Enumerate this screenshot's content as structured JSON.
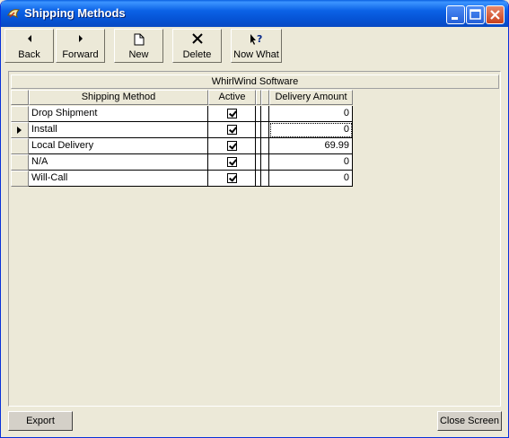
{
  "window": {
    "title": "Shipping Methods"
  },
  "toolbar": {
    "back": "Back",
    "forward": "Forward",
    "new": "New",
    "delete": "Delete",
    "now_what": "Now What"
  },
  "grid": {
    "caption": "WhirlWind Software",
    "columns": [
      "Shipping Method",
      "Active",
      "Delivery Amount"
    ],
    "rows": [
      {
        "name": "Drop Shipment",
        "active": true,
        "amount": "0"
      },
      {
        "name": "Install",
        "active": true,
        "amount": "0",
        "current": true
      },
      {
        "name": "Local Delivery",
        "active": true,
        "amount": "69.99"
      },
      {
        "name": "N/A",
        "active": true,
        "amount": "0"
      },
      {
        "name": "Will-Call",
        "active": true,
        "amount": "0"
      }
    ]
  },
  "footer": {
    "export": "Export",
    "close": "Close Screen"
  }
}
